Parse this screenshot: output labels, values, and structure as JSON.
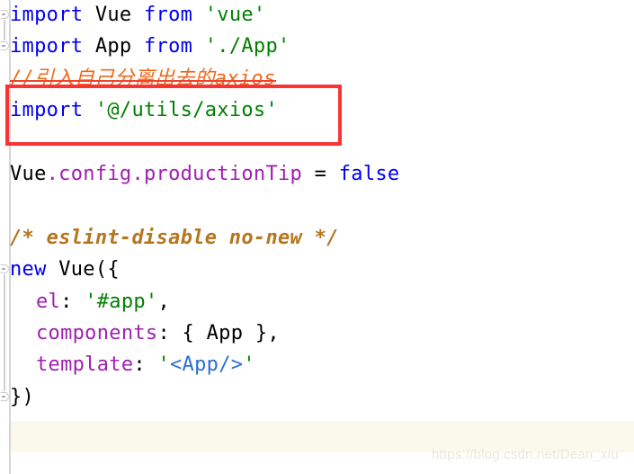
{
  "editor": {
    "language": "javascript",
    "filename_hint": "main.js",
    "colors": {
      "background": "#ffffff",
      "keyword": "#0000ee",
      "string": "#008000",
      "property": "#a020b0",
      "plain_text": "#000000",
      "line_comment": "#ef6a1c",
      "block_comment": "#b5761f",
      "tag": "#2a6fd6",
      "annotation_rect": "#fa3434",
      "current_line_highlight": "#fbf8ec",
      "gutter_rule": "#d6d6d6",
      "error_squiggle": "#3f9f3f",
      "watermark": "#ebe7d9"
    },
    "lines": [
      {
        "n": 1,
        "indent": 0,
        "fold": true,
        "tokens": [
          {
            "t": "import",
            "c": "kw"
          },
          {
            "t": " ",
            "c": "plain"
          },
          {
            "t": "Vue",
            "c": "plain"
          },
          {
            "t": " ",
            "c": "plain"
          },
          {
            "t": "from",
            "c": "kw"
          },
          {
            "t": " ",
            "c": "plain"
          },
          {
            "t": "'vue'",
            "c": "str"
          }
        ]
      },
      {
        "n": 2,
        "indent": 0,
        "fold": true,
        "tokens": [
          {
            "t": "import",
            "c": "kw"
          },
          {
            "t": " ",
            "c": "plain"
          },
          {
            "t": "App",
            "c": "plain"
          },
          {
            "t": " ",
            "c": "plain"
          },
          {
            "t": "from",
            "c": "kw"
          },
          {
            "t": " ",
            "c": "plain"
          },
          {
            "t": "'./App'",
            "c": "str"
          }
        ]
      },
      {
        "n": 3,
        "indent": 0,
        "fold": false,
        "struck": true,
        "tokens": [
          {
            "t": "//引入自己分离出去的axios",
            "c": "cmt-line"
          }
        ]
      },
      {
        "n": 4,
        "indent": 0,
        "fold": false,
        "boxed": true,
        "tokens": [
          {
            "t": "import",
            "c": "kw"
          },
          {
            "t": " ",
            "c": "plain"
          },
          {
            "t": "'@/utils/axios'",
            "c": "str"
          }
        ]
      },
      {
        "n": 5,
        "indent": 0,
        "fold": false,
        "tokens": []
      },
      {
        "n": 6,
        "indent": 0,
        "fold": false,
        "tokens": [
          {
            "t": "Vue",
            "c": "plain"
          },
          {
            "t": ".config.productionTip",
            "c": "prop"
          },
          {
            "t": " = ",
            "c": "plain"
          },
          {
            "t": "false",
            "c": "kw"
          }
        ]
      },
      {
        "n": 7,
        "indent": 0,
        "fold": false,
        "tokens": []
      },
      {
        "n": 8,
        "indent": 0,
        "fold": false,
        "tokens": [
          {
            "t": "/* eslint-disable no-new */",
            "c": "cmt-blk"
          }
        ]
      },
      {
        "n": 9,
        "indent": 0,
        "fold": true,
        "tokens": [
          {
            "t": "new",
            "c": "kw"
          },
          {
            "t": " ",
            "c": "plain"
          },
          {
            "t": "Vue",
            "c": "plain"
          },
          {
            "t": "({",
            "c": "punc"
          }
        ]
      },
      {
        "n": 10,
        "indent": 1,
        "fold": false,
        "tokens": [
          {
            "t": "el",
            "c": "prop"
          },
          {
            "t": ": ",
            "c": "plain"
          },
          {
            "t": "'#app'",
            "c": "str"
          },
          {
            "t": ",",
            "c": "punc"
          }
        ]
      },
      {
        "n": 11,
        "indent": 1,
        "fold": false,
        "tokens": [
          {
            "t": "components",
            "c": "prop"
          },
          {
            "t": ": { ",
            "c": "plain"
          },
          {
            "t": "App",
            "c": "plain"
          },
          {
            "t": " },",
            "c": "plain"
          }
        ]
      },
      {
        "n": 12,
        "indent": 1,
        "fold": false,
        "tokens": [
          {
            "t": "template",
            "c": "prop"
          },
          {
            "t": ": ",
            "c": "plain"
          },
          {
            "t": "'",
            "c": "str"
          },
          {
            "t": "<App/>",
            "c": "tag"
          },
          {
            "t": "'",
            "c": "str"
          }
        ]
      },
      {
        "n": 13,
        "indent": 0,
        "fold": true,
        "tokens": [
          {
            "t": "})",
            "c": "punc"
          }
        ]
      }
    ]
  },
  "annotation": {
    "type": "red-rectangle-highlight",
    "targets_line": 4
  },
  "diagnostics": {
    "squiggle_word": "axios",
    "squiggle_line": 3
  },
  "watermark": {
    "text": "https://blog.csdn.net/Dean_xiu"
  }
}
